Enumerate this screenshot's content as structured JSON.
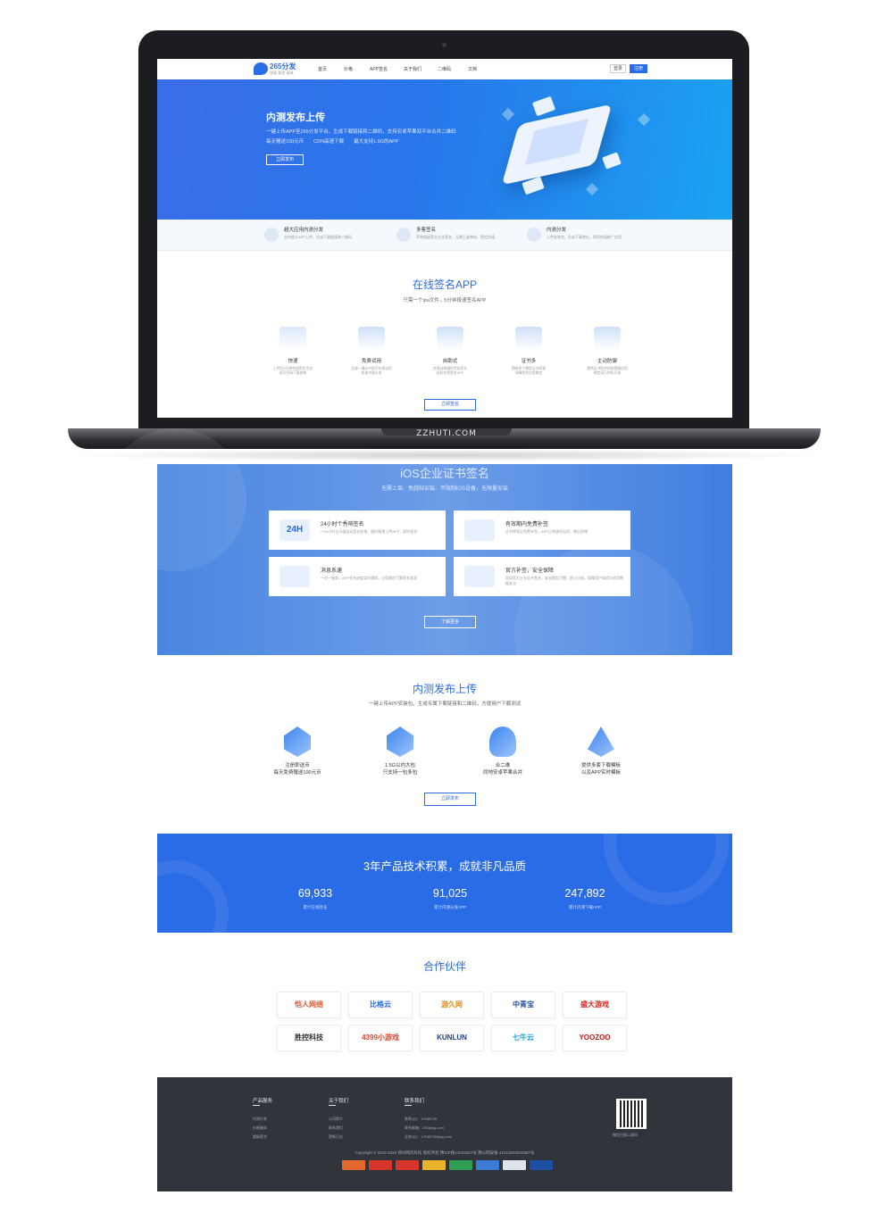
{
  "device": {
    "brand": "ZZHUTI.COM"
  },
  "nav": {
    "logo_text": "265分发",
    "logo_sub": "快速·稳定·高效",
    "items": [
      "首页",
      "价格",
      "APP签名",
      "关于我们",
      "二维码",
      "文档"
    ],
    "login": "登录",
    "register": "注册"
  },
  "hero": {
    "title": "内测发布上传",
    "line1": "一键上传APP至265分发平台，生成下载链接和二维码，支持安卓苹果双平台合并二维码",
    "line2": "每天赠送100元币　　CDN高速下载　　最大支持1.5G的APP",
    "button": "立即发布"
  },
  "features": [
    {
      "title": "超大应用内测分发",
      "desc": "支持超大APP上传，生成下载链接和二维码"
    },
    {
      "title": "多客签名",
      "desc": "苹果超级签名企业签名，无需上架审核，稳定快速"
    },
    {
      "title": "内测分发",
      "desc": "上传安装包，生成下载地址，帮您快速推广应用"
    }
  ],
  "online_sign": {
    "title": "在线签名APP",
    "subtitle": "只需一个ipa文件，5分钟极速签名APP",
    "items": [
      {
        "title": "快速",
        "desc": "上传后5分钟完成签名生成\n即可扫码下载安装"
      },
      {
        "title": "免费试用",
        "desc": "注册一键APP即可在线试用\n实现内测分发"
      },
      {
        "title": "自助式",
        "desc": "在线自助操作完成签名\n轻松在线签名APP"
      },
      {
        "title": "证书多",
        "desc": "拥有多个稳定证书资源\n保障您的应用稳定"
      },
      {
        "title": "主动防御",
        "desc": "提供证书防护机制保障应用\n稳定运行持续可用"
      }
    ],
    "button": "立即签名"
  },
  "ios": {
    "title": "iOS企业证书签名",
    "subtitle": "无需上架、免越狱安装、不限制iOS设备，无限量安装",
    "cards": [
      {
        "title": "24小时个秀响签名",
        "desc": "7*24小时全天候自动签名处理，随时随地上传APP，即时签名"
      },
      {
        "title": "有效期内免费补签",
        "desc": "证书掉签后免费补签，APP正常使用无忧，售后保障"
      },
      {
        "title": "消息系速",
        "desc": "一对一服务，APP签名进度实时通知，让您随时了解签名状态"
      },
      {
        "title": "官方补签，安全保障",
        "desc": "采用官方企业证书签名，安全稳定可靠，防止闪退，保障用户体验与应用数据安全"
      }
    ],
    "card_icons": [
      "24H"
    ],
    "button": "了解更多"
  },
  "upload": {
    "title": "内测发布上传",
    "subtitle": "一键上传APP安装包，生成专属下载链接和二维码，方便用户下载测试",
    "items": [
      {
        "line1": "注册即送币",
        "line2": "每天免费赠送100元币"
      },
      {
        "line1": "1.5G以内大包",
        "line2": "只支持一包多包"
      },
      {
        "line1": "合二维",
        "line2": "同地安卓苹果合并"
      },
      {
        "line1": "提供多套下载模板",
        "line2": "以及APP实时模板"
      }
    ],
    "button": "立即发布"
  },
  "stats": {
    "title": "3年产品技术积累，成就非凡品质",
    "items": [
      {
        "value": "69,933",
        "label": "累计在线签名"
      },
      {
        "value": "91,025",
        "label": "累计内测分发APP"
      },
      {
        "value": "247,892",
        "label": "累计内测下载APP"
      }
    ]
  },
  "partners": {
    "title": "合作伙伴",
    "items": [
      "恺人网络",
      "比格云",
      "游久网",
      "中青宝",
      "盛大游戏",
      "胜控科技",
      "4399小游戏",
      "KUNLUN",
      "七牛云",
      "YOOZOO"
    ],
    "colors": [
      "#e05a2b",
      "#2a6be6",
      "#e58a1a",
      "#1d4fa3",
      "#d6261e",
      "#333333",
      "#e8432c",
      "#1e3e8f",
      "#18a3e0",
      "#c21a1a"
    ]
  },
  "footer": {
    "cols": [
      {
        "title": "产品服务",
        "items": [
          "内测分发",
          "价格服务",
          "超级签名"
        ]
      },
      {
        "title": "关于我们",
        "items": [
          "公司简介",
          "联系我们",
          "更新日志"
        ]
      },
      {
        "title": "联系我们",
        "items": [
          "联系QQ：17048739",
          "联系邮箱：265@qq.com",
          "业务QQ：17048739@qq.com"
        ]
      }
    ],
    "qr_label": "微信扫描二维码",
    "copyright": "Copyright © 2018-2020 郑州网风科技 版权所有 豫ICP备14003457号   豫公网安备 41010502002887号"
  },
  "colors": {
    "accent": "#2a6be6",
    "footer_bg": "#31343a",
    "stats_bg": "#2a6be6"
  }
}
